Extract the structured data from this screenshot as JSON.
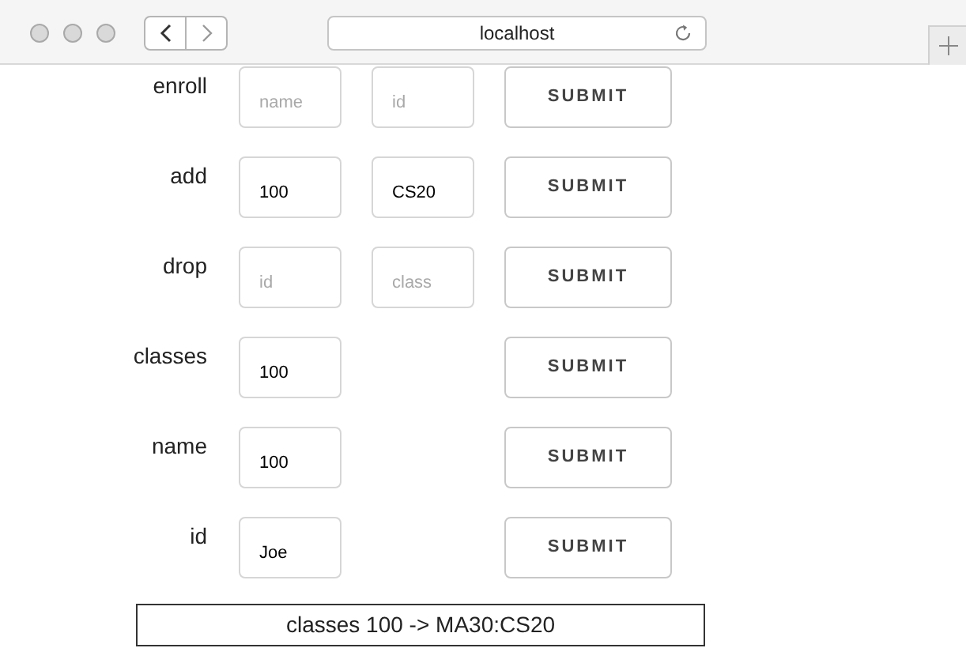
{
  "browser": {
    "address": "localhost"
  },
  "forms": [
    {
      "label": "enroll",
      "fields": [
        {
          "placeholder": "name"
        },
        {
          "placeholder": "id"
        }
      ],
      "button": "SUBMIT"
    },
    {
      "label": "add",
      "fields": [
        {
          "value": "100"
        },
        {
          "value": "CS20"
        }
      ],
      "button": "SUBMIT"
    },
    {
      "label": "drop",
      "fields": [
        {
          "placeholder": "id"
        },
        {
          "placeholder": "class"
        }
      ],
      "button": "SUBMIT"
    },
    {
      "label": "classes",
      "fields": [
        {
          "value": "100"
        }
      ],
      "button": "SUBMIT"
    },
    {
      "label": "name",
      "fields": [
        {
          "value": "100"
        }
      ],
      "button": "SUBMIT"
    },
    {
      "label": "id",
      "fields": [
        {
          "value": "Joe"
        }
      ],
      "button": "SUBMIT"
    }
  ],
  "output": "classes 100 -> MA30:CS20"
}
